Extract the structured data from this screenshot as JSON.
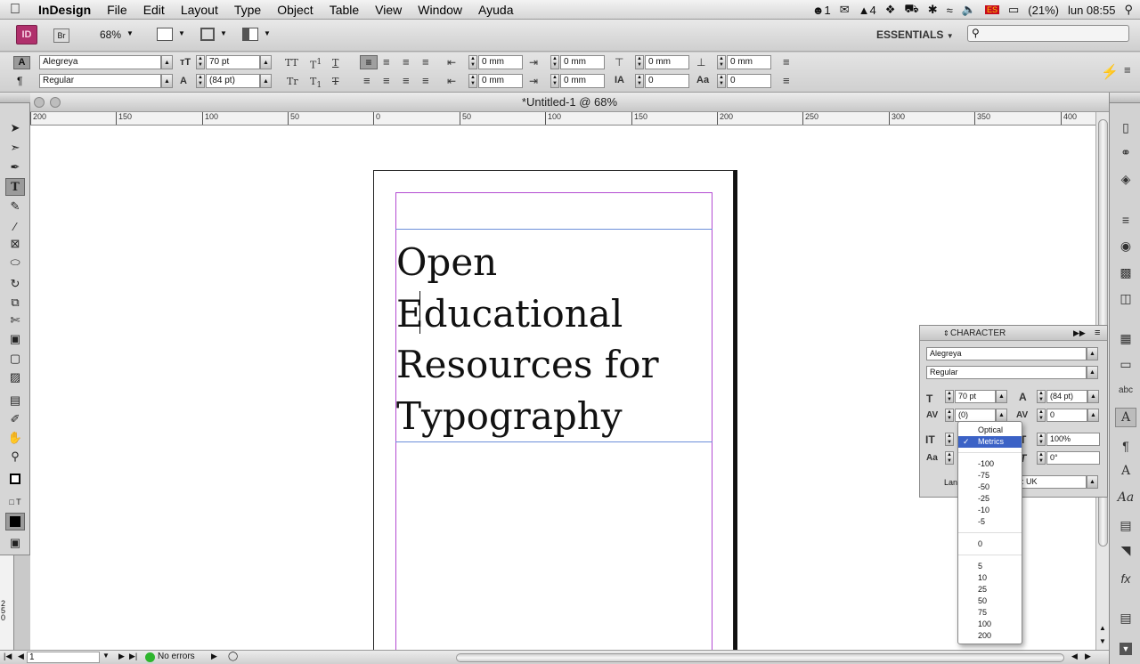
{
  "menubar": {
    "items": [
      "InDesign",
      "File",
      "Edit",
      "Layout",
      "Type",
      "Object",
      "Table",
      "View",
      "Window",
      "Ayuda"
    ],
    "status": {
      "badge": "1",
      "text_4": "4",
      "battery": "(21%)",
      "clock": "lun 08:55"
    }
  },
  "appbar": {
    "id_logo": "ID",
    "br_logo": "Br",
    "zoom": "68%",
    "workspace": "ESSENTIALS"
  },
  "control": {
    "font_family": "Alegreya",
    "font_style": "Regular",
    "font_size": "70 pt",
    "leading": "(84 pt)",
    "indent_left": "0 mm",
    "indent_right": "0 mm",
    "indent_first": "0 mm",
    "indent_last": "0 mm",
    "space_before": "0 mm",
    "space_after": "0 mm",
    "drop_lines": "0",
    "drop_chars": "0"
  },
  "document": {
    "title": "*Untitled-1 @ 68%",
    "ruler_ticks": [
      "200",
      "150",
      "100",
      "50",
      "0",
      "50",
      "100",
      "150",
      "200",
      "250",
      "300",
      "350",
      "400"
    ],
    "vruler_label": "250",
    "headline": [
      "Open",
      "Educational",
      "Resources for",
      "Typography"
    ]
  },
  "status_bar": {
    "page": "1",
    "errors": "No errors"
  },
  "character_panel": {
    "title": "CHARACTER",
    "font_family": "Alegreya",
    "font_style": "Regular",
    "size": "70 pt",
    "leading": "(84 pt)",
    "kerning": "(0)",
    "tracking": "0",
    "horiz_scale": "100%",
    "skew": "0°",
    "language_label": "Lan",
    "language": ": UK"
  },
  "kerning_menu": {
    "items": [
      "Optical",
      "Metrics",
      "-100",
      "-75",
      "-50",
      "-25",
      "-10",
      "-5",
      "0",
      "5",
      "10",
      "25",
      "50",
      "75",
      "100",
      "200"
    ],
    "checked": "Metrics"
  },
  "colors": {
    "accent_margin": "#b34bd2",
    "frame_guide": "#6c8fd9",
    "menu_highlight": "#3b62c6"
  }
}
